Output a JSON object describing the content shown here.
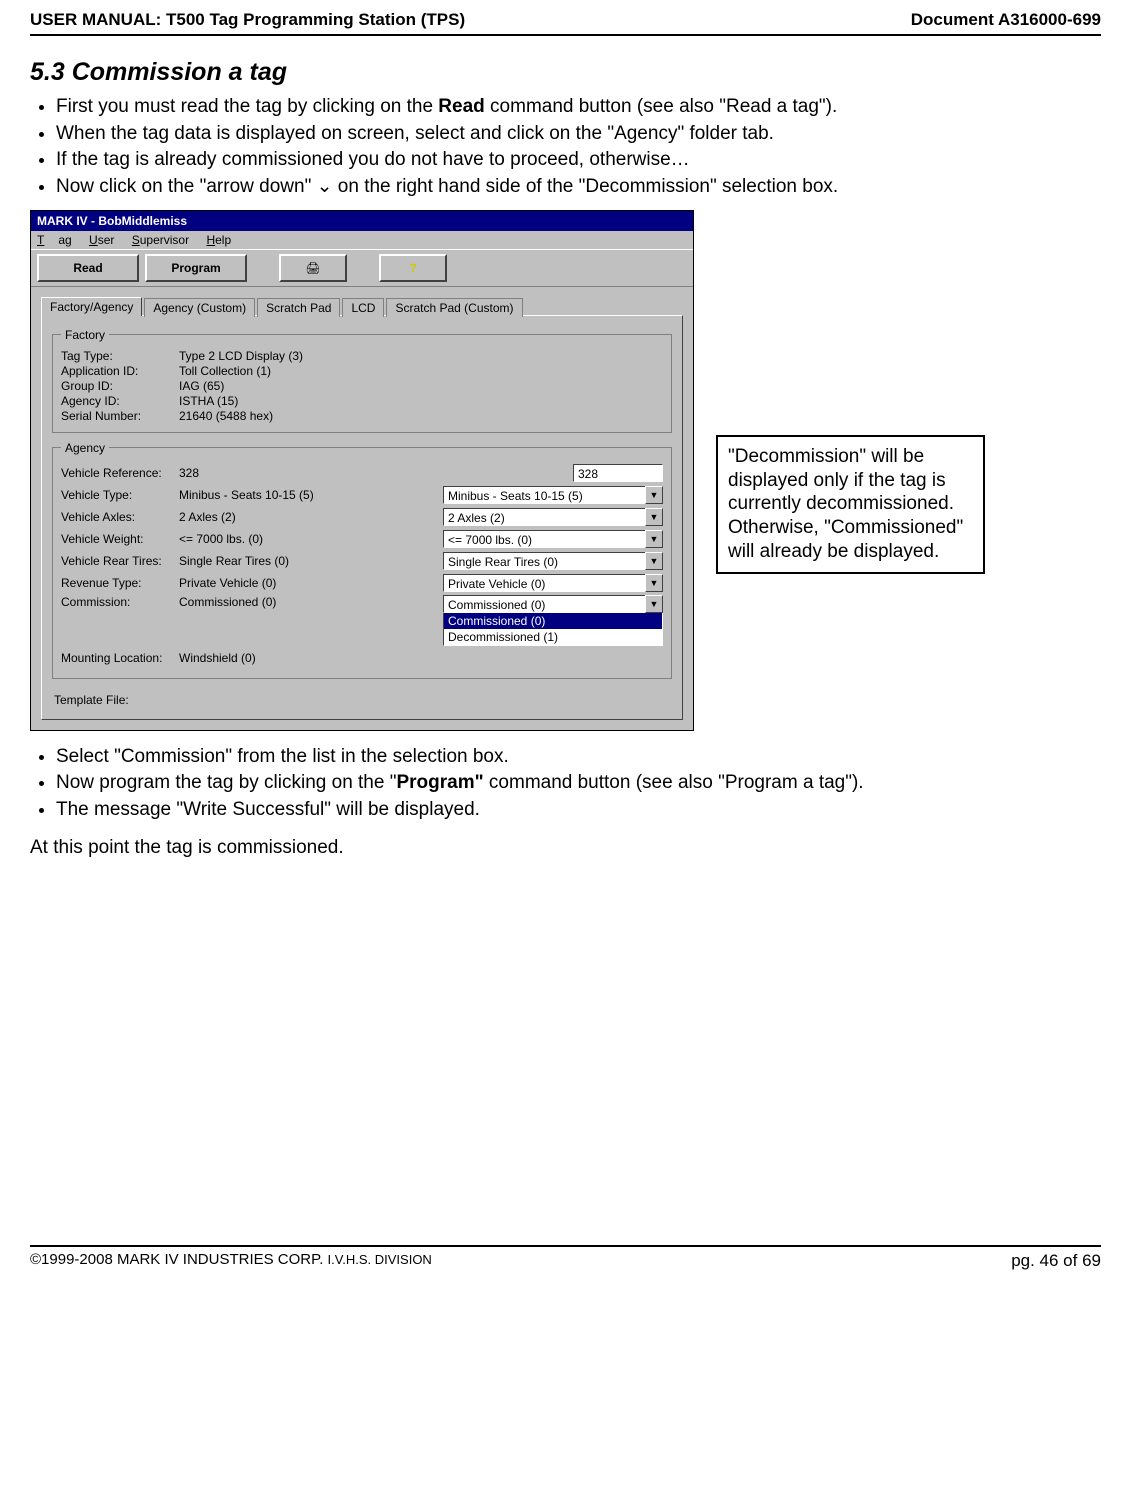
{
  "header": {
    "left": "USER MANUAL: T500 Tag Programming Station (TPS)",
    "right": "Document A316000-699"
  },
  "section_heading": "5.3 Commission a tag",
  "bullets_top": [
    {
      "pre": "First you must read the tag by clicking on the ",
      "bold": "Read",
      "post": " command button (see also \"Read a tag\")."
    },
    {
      "pre": "When the tag data is displayed on screen, select and click on the \"Agency\" folder tab.",
      "bold": "",
      "post": ""
    },
    {
      "pre": "If the tag is already commissioned you do not have to proceed, otherwise…",
      "bold": "",
      "post": ""
    },
    {
      "pre": "Now click on the \"arrow down\" ⌄ on the right hand side of the \"Decommission\" selection box.",
      "bold": "",
      "post": ""
    }
  ],
  "window": {
    "title": "MARK IV - BobMiddlemiss",
    "menus": {
      "m0": "Tag",
      "m1": "User",
      "m2": "Supervisor",
      "m3": "Help"
    },
    "toolbar": {
      "read": "Read",
      "program": "Program",
      "print_icon": "🖨",
      "help_icon": "?"
    },
    "tabs": {
      "t0": "Factory/Agency",
      "t1": "Agency (Custom)",
      "t2": "Scratch Pad",
      "t3": "LCD",
      "t4": "Scratch Pad (Custom)"
    },
    "factory_legend": "Factory",
    "factory": {
      "r0k": "Tag Type:",
      "r0v": "Type 2 LCD Display (3)",
      "r1k": "Application ID:",
      "r1v": "Toll Collection (1)",
      "r2k": "Group ID:",
      "r2v": "IAG (65)",
      "r3k": "Agency ID:",
      "r3v": "ISTHA (15)",
      "r4k": "Serial Number:",
      "r4v": "21640 (5488 hex)"
    },
    "agency_legend": "Agency",
    "agency": {
      "r0k": "Vehicle Reference:",
      "r0v": "328",
      "r0c": "328",
      "r1k": "Vehicle Type:",
      "r1v": "Minibus - Seats 10-15 (5)",
      "r1c": "Minibus - Seats 10-15 (5)",
      "r2k": "Vehicle Axles:",
      "r2v": "2 Axles (2)",
      "r2c": "2 Axles (2)",
      "r3k": "Vehicle Weight:",
      "r3v": "<= 7000 lbs. (0)",
      "r3c": "<= 7000 lbs. (0)",
      "r4k": "Vehicle Rear Tires:",
      "r4v": "Single Rear Tires (0)",
      "r4c": "Single Rear Tires (0)",
      "r5k": "Revenue Type:",
      "r5v": "Private Vehicle (0)",
      "r5c": "Private Vehicle (0)",
      "r6k": "Commission:",
      "r6v": "Commissioned (0)",
      "r6c": "Commissioned (0)",
      "r6opt0": "Commissioned (0)",
      "r6opt1": "Decommissioned (1)",
      "r7k": "Mounting Location:",
      "r7v": "Windshield (0)"
    },
    "template_label": "Template File:"
  },
  "callout": "\"Decommission\" will be displayed only if the tag is currently decommissioned. Otherwise, \"Commissioned\" will already be displayed.",
  "bullets_bottom": [
    {
      "pre": "Select \"Commission\" from the list in the selection box.",
      "bold": "",
      "post": ""
    },
    {
      "pre": "Now program the tag by clicking on the \"",
      "bold": "Program\"",
      "post": " command button (see also \"Program a tag\")."
    },
    {
      "pre": "The message \"Write Successful\" will be displayed.",
      "bold": "",
      "post": ""
    }
  ],
  "closing": "At this point the tag is commissioned.",
  "footer": {
    "left_a": "©1999-2008 MARK IV INDUSTRIES CORP. ",
    "left_b": "I.V.H.S. DIVISION",
    "right": "pg. 46 of 69"
  }
}
